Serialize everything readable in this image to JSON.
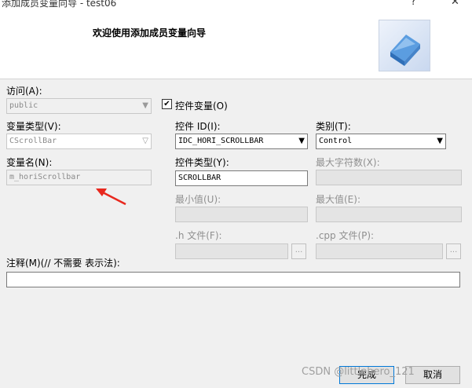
{
  "window": {
    "title": "添加成员变量向导 - test06",
    "help_glyph": "?",
    "close_glyph": "✕"
  },
  "header": {
    "title": "欢迎使用添加成员变量向导"
  },
  "form": {
    "access_label": "访问(A):",
    "access_value": "public",
    "control_var_label": "控件变量(O)",
    "control_var_checked": true,
    "var_type_label": "变量类型(V):",
    "var_type_value": "CScrollBar",
    "var_name_label": "变量名(N):",
    "var_name_value": "m_horiScrollbar",
    "control_id_label": "控件 ID(I):",
    "control_id_value": "IDC_HORI_SCROLLBAR",
    "category_label": "类别(T):",
    "category_value": "Control",
    "control_type_label": "控件类型(Y):",
    "control_type_value": "SCROLLBAR",
    "max_chars_label": "最大字符数(X):",
    "min_value_label": "最小值(U):",
    "max_value_label": "最大值(E):",
    "h_file_label": ".h 文件(F):",
    "cpp_file_label": ".cpp 文件(P):",
    "browse_label": "...",
    "comment_label": "注释(M)(// 不需要 表示法):",
    "comment_value": ""
  },
  "buttons": {
    "finish": "完成",
    "cancel": "取消"
  },
  "watermark": "CSDN @littlehero_121",
  "annotation_color": "#e8281e"
}
